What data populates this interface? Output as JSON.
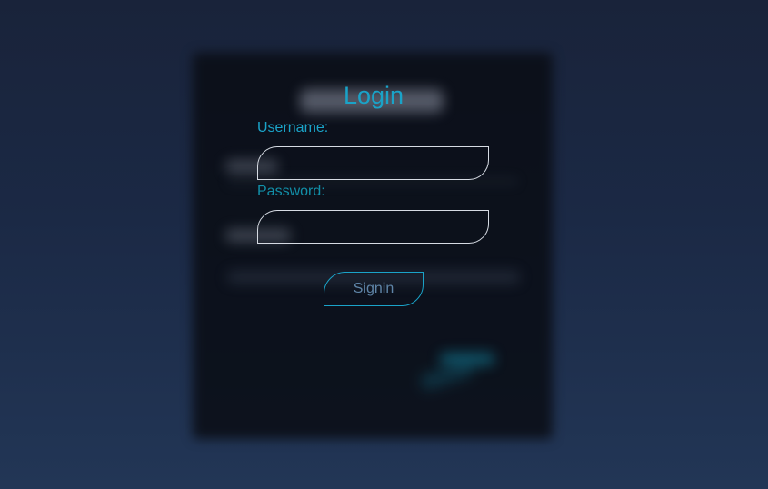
{
  "form": {
    "title": "Login",
    "username_label": "Username:",
    "username_value": "",
    "password_label": "Password:",
    "password_value": "",
    "signin_label": "Signin"
  },
  "colors": {
    "accent": "#1aa3c8",
    "field_border": "#d6dbe3",
    "button_text": "#5f85a8",
    "background_top": "#19233a",
    "background_bottom": "#223656"
  }
}
